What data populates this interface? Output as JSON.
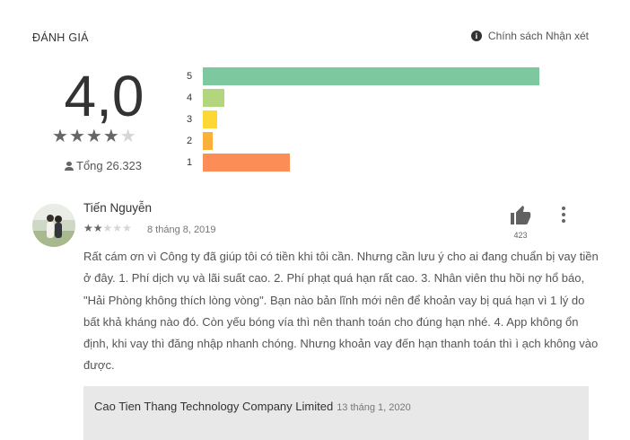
{
  "section": {
    "title": "ĐÁNH GIÁ",
    "policy_label": "Chính sách Nhận xét"
  },
  "summary": {
    "score": "4,0",
    "stars": 4,
    "total": "Tổng 26.323"
  },
  "histogram": [
    {
      "label": "5",
      "fraction": 0.625,
      "color": "#7ec8a0"
    },
    {
      "label": "4",
      "fraction": 0.04,
      "color": "#b2d67d"
    },
    {
      "label": "3",
      "fraction": 0.027,
      "color": "#fdd835"
    },
    {
      "label": "2",
      "fraction": 0.018,
      "color": "#fbb03b"
    },
    {
      "label": "1",
      "fraction": 0.162,
      "color": "#fd8d57"
    }
  ],
  "review": {
    "author": "Tiến Nguyễn",
    "stars": 2,
    "date": "8 tháng 8, 2019",
    "likes": "423",
    "text": "Rất cám ơn vì Công ty đã giúp tôi có tiền khi tôi cần. Nhưng cần lưu ý cho ai đang chuẩn bị vay tiền ở đây. 1. Phí dịch vụ và lãi suất cao. 2. Phí phạt quá hạn rất cao. 3. Nhân viên thu hồi nợ hổ báo, \"Hải Phòng không thích lòng vòng\". Bạn nào bản lĩnh mới nên để khoản vay bị quá hạn vì 1 lý do bất khả kháng nào đó. Còn yếu bóng vía thì nên thanh toán cho đúng hạn nhé. 4. App không ổn định, khi vay thì đăng nhập nhanh chóng. Nhưng khoản vay đến hạn thanh toán thì ì ạch không vào được."
  },
  "reply": {
    "developer": "Cao Tien Thang Technology Company Limited",
    "date": "13 tháng 1, 2020",
    "text": ""
  }
}
